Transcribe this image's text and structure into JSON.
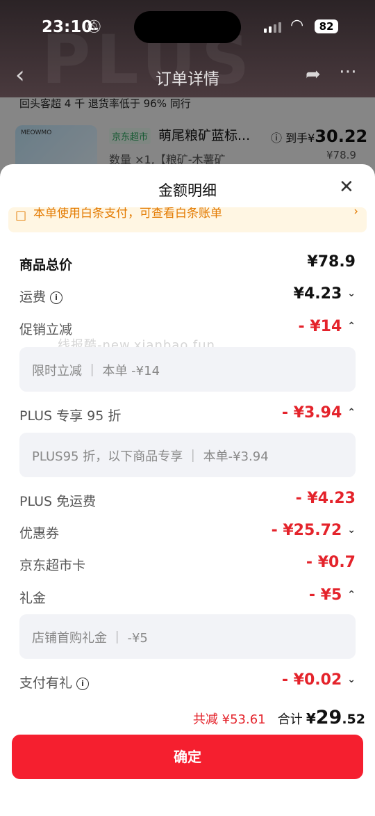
{
  "status_bar": {
    "time": "23:10",
    "battery": "82"
  },
  "navbar": {
    "title": "订单详情",
    "watermark_text": "PLUS"
  },
  "background_order": {
    "shop_stats": "回头客超 4 千   退货率低于 96% 同行",
    "tag": "京东超市",
    "product_name": "萌尾粮矿蓝标...",
    "arrive_prefix": "到手",
    "arrive_currency": "¥",
    "arrive_price": "30.22",
    "original_price": "¥78.9",
    "quantity": "数量 ×1,【粮矿-木薯矿",
    "thumb_brand": "MEOWMO"
  },
  "sheet": {
    "title": "金额明细",
    "notice": "本单使用白条支付，可查看白条账单",
    "rows": [
      {
        "label": "商品总价",
        "amount": "¥78.9"
      },
      {
        "label": "运费",
        "amount": "¥4.23"
      },
      {
        "label": "促销立减",
        "amount": "- ¥14"
      },
      {
        "label": "PLUS 专享 95 折",
        "amount": "- ¥3.94"
      },
      {
        "label": "PLUS 免运费",
        "amount": "- ¥4.23"
      },
      {
        "label": "优惠券",
        "amount": "- ¥25.72"
      },
      {
        "label": "京东超市卡",
        "amount": "- ¥0.7"
      },
      {
        "label": "礼金",
        "amount": "- ¥5"
      },
      {
        "label": "支付有礼",
        "amount": "- ¥0.02"
      }
    ],
    "details": {
      "promo": "限时立减  ｜  本单 -¥14",
      "plus95": "PLUS95 折，以下商品专享  ｜  本单-¥3.94",
      "gift": "店铺首购礼金  ｜  -¥5"
    },
    "watermark": "线报酷-new.xianbao.fun",
    "summary": {
      "saved": "共减 ¥53.61",
      "total_label": "合计",
      "total_currency": "¥",
      "total_int": "29",
      "total_dec": ".52"
    },
    "confirm_label": "确定"
  },
  "colors": {
    "accent_red": "#e4232b",
    "button_red": "#f51f2f",
    "jd_green": "#2aa35d",
    "notice_orange": "#e37a00"
  }
}
